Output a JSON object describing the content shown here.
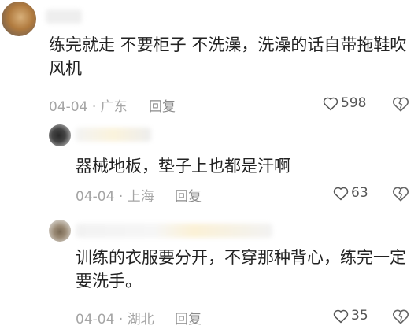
{
  "comments": [
    {
      "text": "练完就走 不要柜子 不洗澡，洗澡的话自带拖鞋吹风机",
      "date": "04-04",
      "location": "广东",
      "reply_label": "回复",
      "likes": "598"
    },
    {
      "text": "器械地板，垫子上也都是汗啊",
      "date": "04-04",
      "location": "上海",
      "reply_label": "回复",
      "likes": "63"
    },
    {
      "text": "训练的衣服要分开，不穿那种背心，练完一定要洗手。",
      "date": "04-04",
      "location": "湖北",
      "reply_label": "回复",
      "likes": "35"
    }
  ],
  "separator": "·",
  "icons": {
    "like": "heart-outline-icon",
    "dislike": "broken-heart-icon"
  }
}
